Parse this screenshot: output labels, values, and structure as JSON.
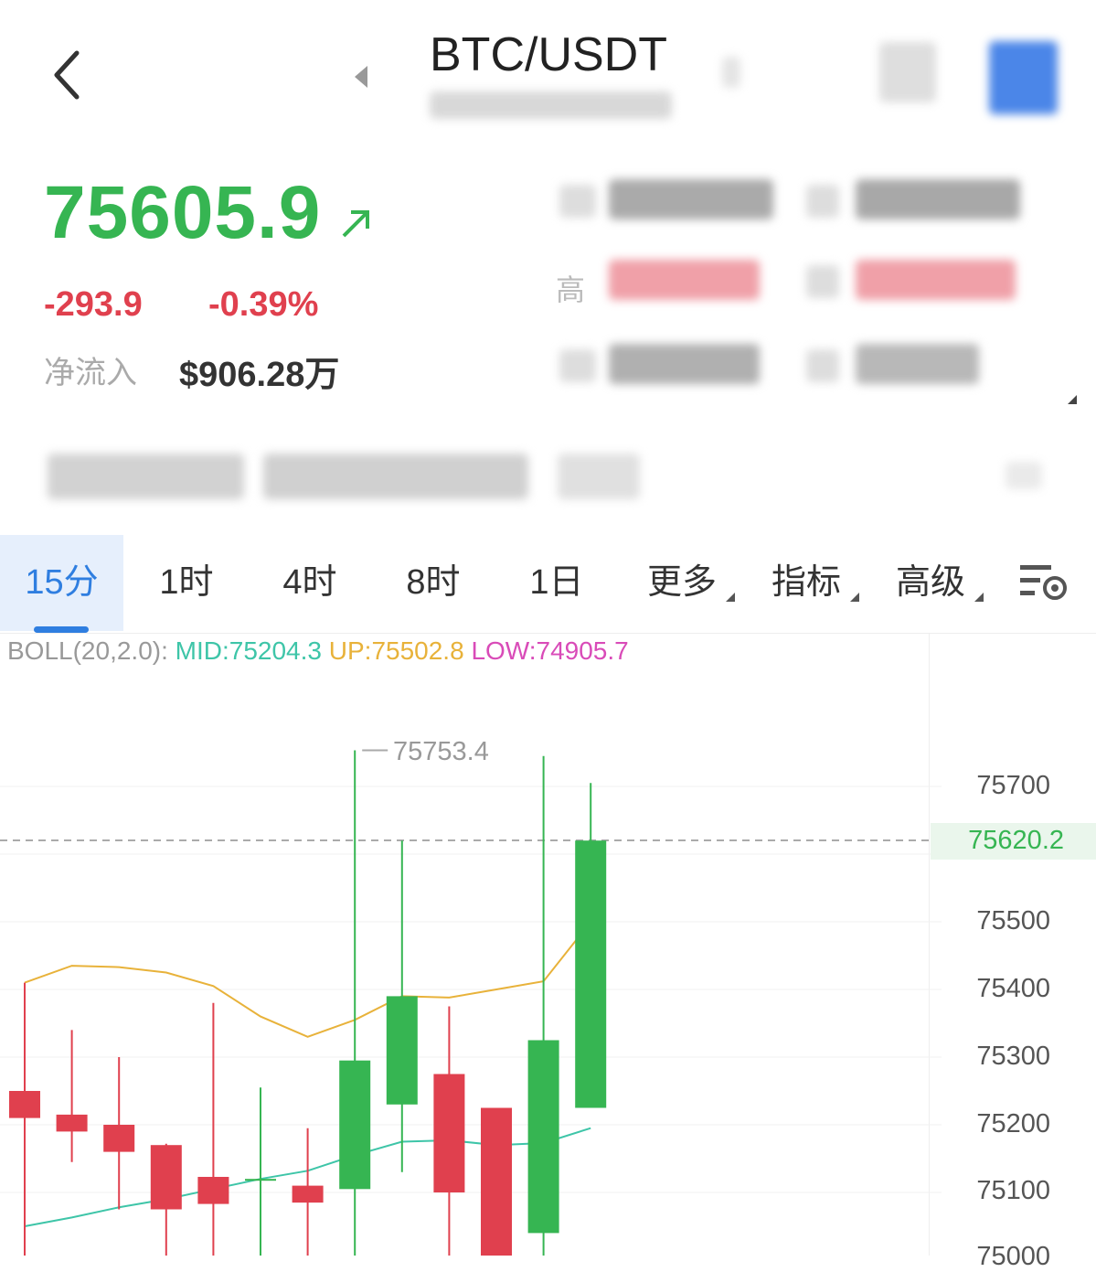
{
  "header": {
    "title": "BTC/USDT"
  },
  "ticker": {
    "price": "75605.9",
    "change": "-293.9",
    "change_pct": "-0.39%",
    "netflow_label": "净流入",
    "netflow_value": "$906.28万",
    "high_label": "高"
  },
  "tabs": [
    {
      "label": "15分",
      "active": true
    },
    {
      "label": "1时"
    },
    {
      "label": "4时"
    },
    {
      "label": "8时"
    },
    {
      "label": "1日"
    },
    {
      "label": "更多"
    },
    {
      "label": "指标"
    },
    {
      "label": "高级"
    }
  ],
  "indicator": {
    "name": "BOLL(20,2.0):",
    "mid": "MID:75204.3",
    "up": "UP:75502.8",
    "low": "LOW:74905.7"
  },
  "colors": {
    "up": "#36b552",
    "down": "#e0404e",
    "mid_line": "#3ec5a8",
    "up_line": "#e8b23a",
    "low_line": "#d94bb8",
    "accent": "#2f7ee0"
  },
  "chart_data": {
    "type": "candlestick",
    "y_ticks": [
      "75700",
      "75600",
      "75500",
      "75400",
      "75300",
      "75200",
      "75100",
      "75000"
    ],
    "ylim": [
      74960,
      75920
    ],
    "high_marker": "75753.4",
    "current_price": "75620.2",
    "candles": [
      {
        "o": 75250,
        "c": 75210,
        "h": 75410,
        "l": 74960
      },
      {
        "o": 75215,
        "c": 75190,
        "h": 75340,
        "l": 75145
      },
      {
        "o": 75200,
        "c": 75160,
        "h": 75300,
        "l": 75075
      },
      {
        "o": 75170,
        "c": 75075,
        "h": 75172,
        "l": 74970
      },
      {
        "o": 75123,
        "c": 75083,
        "h": 75380,
        "l": 74970
      },
      {
        "o": 75120,
        "c": 75120,
        "h": 75255,
        "l": 74970
      },
      {
        "o": 75110,
        "c": 75085,
        "h": 75195,
        "l": 74970
      },
      {
        "o": 75105,
        "c": 75295,
        "h": 75753.4,
        "l": 74970
      },
      {
        "o": 75230,
        "c": 75390,
        "h": 75620,
        "l": 75130
      },
      {
        "o": 75275,
        "c": 75100,
        "h": 75375,
        "l": 74960
      },
      {
        "o": 75225,
        "c": 74960,
        "h": 75225,
        "l": 74960
      },
      {
        "o": 75040,
        "c": 75325,
        "h": 75745,
        "l": 74970
      },
      {
        "o": 75225,
        "c": 75620,
        "h": 75705,
        "l": 75225
      }
    ],
    "boll_up": [
      [
        0,
        75410
      ],
      [
        1,
        75435
      ],
      [
        2,
        75433
      ],
      [
        3,
        75425
      ],
      [
        4,
        75405
      ],
      [
        5,
        75360
      ],
      [
        6,
        75330
      ],
      [
        7,
        75355
      ],
      [
        8,
        75390
      ],
      [
        9,
        75388
      ],
      [
        10,
        75400
      ],
      [
        11,
        75412
      ],
      [
        12,
        75500
      ]
    ],
    "boll_mid": [
      [
        0,
        75050
      ],
      [
        1,
        75063
      ],
      [
        2,
        75078
      ],
      [
        3,
        75090
      ],
      [
        4,
        75105
      ],
      [
        5,
        75120
      ],
      [
        6,
        75132
      ],
      [
        7,
        75155
      ],
      [
        8,
        75175
      ],
      [
        9,
        75177
      ],
      [
        10,
        75170
      ],
      [
        11,
        75173
      ],
      [
        12,
        75195
      ]
    ]
  }
}
